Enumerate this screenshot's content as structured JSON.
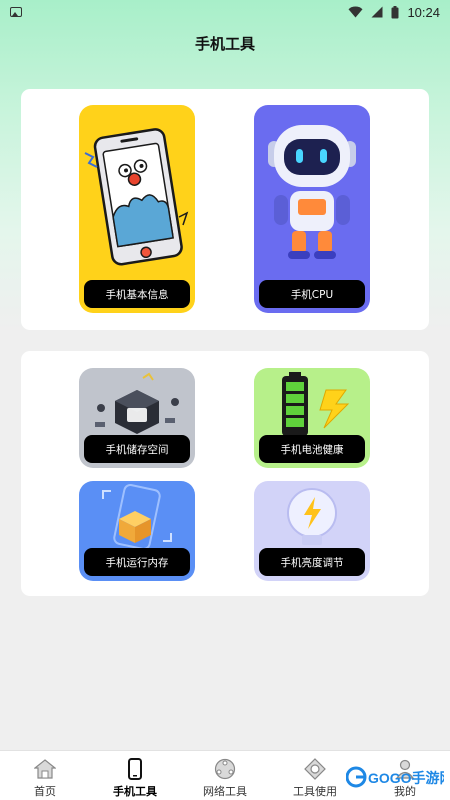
{
  "status_bar": {
    "time": "10:24"
  },
  "header": {
    "title": "手机工具"
  },
  "tools_primary": [
    {
      "label": "手机基本信息",
      "icon": "phone-cartoon-icon",
      "bg": "#ffd21a"
    },
    {
      "label": "手机CPU",
      "icon": "robot-icon",
      "bg": "#6a6cf0"
    }
  ],
  "tools_secondary": [
    {
      "label": "手机储存空间",
      "icon": "storage-chip-icon",
      "bg": "#c0c4cc"
    },
    {
      "label": "手机电池健康",
      "icon": "battery-icon",
      "bg": "#b7f08a"
    },
    {
      "label": "手机运行内存",
      "icon": "memory-box-icon",
      "bg": "#5a8ff5"
    },
    {
      "label": "手机亮度调节",
      "icon": "lightbulb-icon",
      "bg": "#d2d3f8"
    }
  ],
  "bottom_nav": [
    {
      "label": "首页",
      "icon": "home-icon",
      "active": false
    },
    {
      "label": "手机工具",
      "icon": "phone-icon",
      "active": true
    },
    {
      "label": "网络工具",
      "icon": "network-icon",
      "active": false
    },
    {
      "label": "工具使用",
      "icon": "tool-usage-icon",
      "active": false
    },
    {
      "label": "我的",
      "icon": "profile-icon",
      "active": false
    }
  ],
  "watermark": {
    "text": "GOGO手游网",
    "logo": "gogo-logo-icon"
  }
}
